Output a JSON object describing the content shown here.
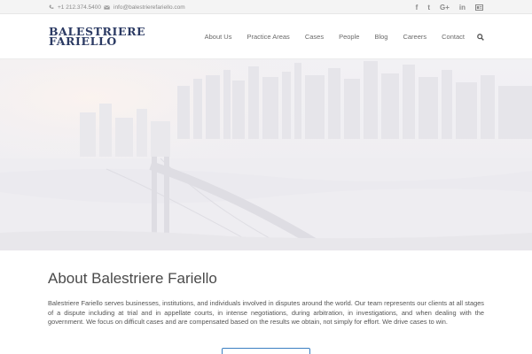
{
  "topbar": {
    "phone": "+1 212.374.5400",
    "email": "info@balestrierefariello.com",
    "social_icons": [
      "facebook-icon",
      "twitter-icon",
      "google-plus-icon",
      "linkedin-icon",
      "email-card-icon"
    ],
    "social_glyphs": [
      "f",
      "t",
      "G+",
      "in"
    ]
  },
  "header": {
    "logo_line1": "BALESTRIERE",
    "logo_line2": "FARIELLO",
    "nav": [
      "About Us",
      "Practice Areas",
      "Cases",
      "People",
      "Blog",
      "Careers",
      "Contact"
    ]
  },
  "about": {
    "title": "About Balestriere Fariello",
    "body": "Balestriere Fariello serves businesses, institutions, and individuals involved in disputes around the world. Our team represents our clients at all stages of a dispute including at trial and in appellate courts, in intense negotiations, during arbitration, in investigations, and when dealing with the government. We focus on difficult cases and are compensated based on the results we obtain, not simply for effort. We drive cases to win."
  },
  "colors": {
    "logo": "#2b3a63",
    "accent": "#3a7fc2",
    "topbar_bg": "#f4f4f4"
  }
}
